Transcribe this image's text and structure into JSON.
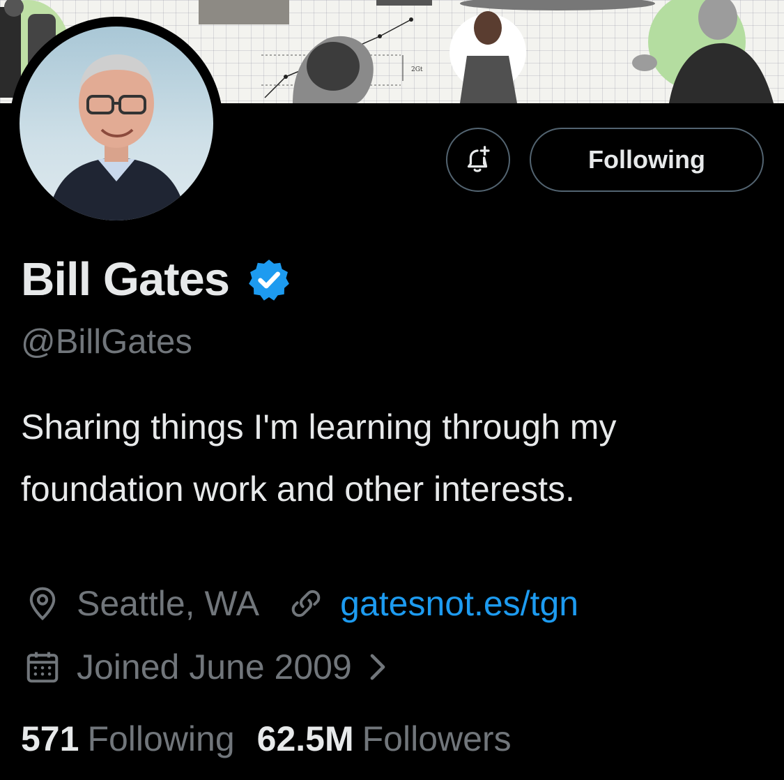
{
  "banner": {
    "chart_label": "2Gt"
  },
  "profile": {
    "name": "Bill Gates",
    "handle": "@BillGates",
    "bio": "Sharing things I'm learning through my foundation work and other interests.",
    "location": "Seattle, WA",
    "website": "gatesnot.es/tgn",
    "joined": "Joined June 2009",
    "following_count": "571",
    "following_label": "Following",
    "followers_count": "62.5M",
    "followers_label": "Followers"
  },
  "actions": {
    "follow_button_label": "Following",
    "notify_icon": "bell-plus-icon"
  },
  "icons": {
    "verified": "verified-badge-icon",
    "location": "location-pin-icon",
    "link": "link-icon",
    "calendar": "calendar-icon",
    "joined_chevron": "chevron-right-icon"
  },
  "colors": {
    "background": "#000000",
    "primary_text": "#e7e9ea",
    "secondary_text": "#71767b",
    "link": "#1d9bf0",
    "verified": "#1d9bf0",
    "button_border": "#536471"
  }
}
